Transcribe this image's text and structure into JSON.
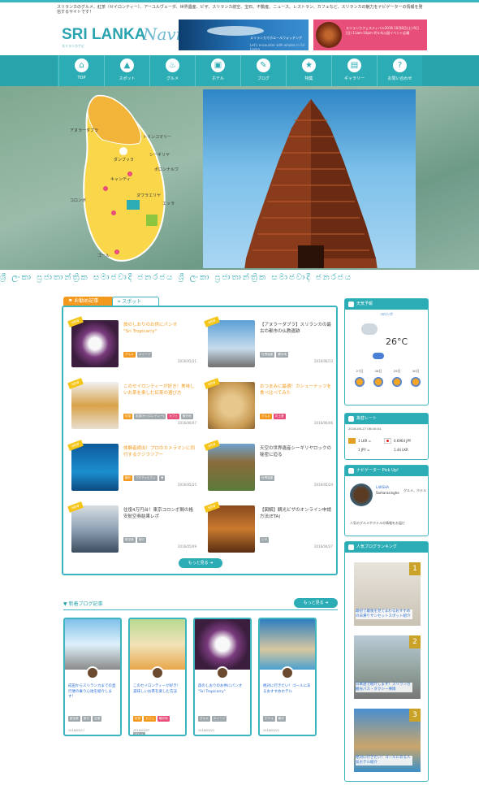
{
  "site": {
    "tagline": "スリランカのグルメ、紅茶（セイロンティー）、アーユルヴェーダ、世界遺産、ビザ、スリランカ航空、宝石、不動産、ニュース、レストラン、カフェなど、スリランカの魅力をナビゲーターの情報を発信するサイトです！",
    "logo_main": "SRI LANKA",
    "logo_script": "Navi",
    "logo_sub": "スリランカナビ"
  },
  "banners": {
    "whale_line1": "スリランカでホエールウォッチング",
    "whale_line2": "Let's encounter with whales in Sri Lanka",
    "festival_text": "スリランカフェスティバル2016 10月8日(土)-9日(日) 11am-10pm 代々木公園イベント広場"
  },
  "nav": [
    {
      "label": "TOP",
      "icon": "home-icon",
      "glyph": "⌂"
    },
    {
      "label": "スポット",
      "icon": "spot-icon",
      "glyph": "▲"
    },
    {
      "label": "グルメ",
      "icon": "gourmet-icon",
      "glyph": "♨"
    },
    {
      "label": "ホテル",
      "icon": "hotel-icon",
      "glyph": "▣"
    },
    {
      "label": "ブログ",
      "icon": "blog-icon",
      "glyph": "✎"
    },
    {
      "label": "特集",
      "icon": "feature-icon",
      "glyph": "★"
    },
    {
      "label": "ギャラリー",
      "icon": "gallery-icon",
      "glyph": "▤"
    },
    {
      "label": "お問い合わせ",
      "icon": "contact-icon",
      "glyph": "?"
    }
  ],
  "hero_map": {
    "labels": [
      "アヌラーダプラ",
      "トリンコマリー",
      "シーギリヤ",
      "ダンブッラ",
      "ポロンナルワ",
      "キャンディ",
      "コロンボ",
      "ヌワラエリヤ",
      "エッラ",
      "ゴール"
    ]
  },
  "script_band": "ශ්‍රී ලංකා ප්‍රජාතාන්ත්‍රික සමාජවාදී ජනරජය ශ්‍රී ලංකා ප්‍රජාතාන්ත්‍රික සමාජවාදී ජනරජය",
  "tabs": {
    "recommend": "お勧め記事",
    "spot": "スポット"
  },
  "articles": [
    {
      "title": "旅のしおりのお供にパンオ",
      "title2": "\"Sri Tropicarry\"",
      "date": "2016/05/21",
      "tags": [
        "グルメ",
        "スイーツ"
      ],
      "dark": false
    },
    {
      "title": "【アヌラーダプラ】スリランカの最古の都市の仏教遺跡",
      "date": "2016/06/13",
      "tags": [
        "世界遺産",
        "観光地"
      ],
      "dark": true
    },
    {
      "title": "このセイロンティーが好き！美味しいお茶を楽しむ紅茶の選び方",
      "date": "2016/06/07",
      "tags": [
        "紅茶",
        "紅茶(セイロンティー)",
        "カフェ",
        "観光地"
      ],
      "dark": false
    },
    {
      "title": "おつまみに最適！カシューナッツを食べ比べてみた",
      "date": "2016/06/06",
      "tags": [
        "グルメ",
        "お土産"
      ],
      "dark": false
    },
    {
      "title": "体験者続出！プロのカメラマンに同行するクジラツアー",
      "date": "2016/05/25",
      "tags": [
        "観光",
        "アクティビティ",
        "海"
      ],
      "dark": false
    },
    {
      "title": "天空の世界遺産シーギリヤロックの秘密に迫る",
      "date": "2016/05/24",
      "tags": [
        "世界遺産"
      ],
      "dark": true
    },
    {
      "title": "往復4万円台！東京コロンボ間の格安航空券結果レポ",
      "date": "2016/05/09",
      "tags": [
        "航空券",
        "旅行"
      ],
      "dark": true
    },
    {
      "title": "【図解】観光ビザのオンライン申請方法(ETA)",
      "date": "2016/04/27",
      "tags": [
        "ビザ"
      ],
      "dark": true
    }
  ],
  "more_label": "もっと見る",
  "blog_section": {
    "heading": "新着ブログ記事",
    "more_label": "もっと見る",
    "cards": [
      {
        "title": "成田からスリランカまでの直行便の乗り心地を紹介します！",
        "date": "2016/05/17",
        "tags": [
          "航空券",
          "旅行",
          "空港"
        ]
      },
      {
        "title": "このセイロンティーが好き！美味しいお茶を楽しむ方法",
        "date": "2016/05/07",
        "tags": [
          "紅茶",
          "カフェ",
          "観光地",
          "グルメ"
        ]
      },
      {
        "title": "旅のしおりのお供にパンオ \"Sri Tropicarry\"",
        "date": "2016/05/21",
        "tags": [
          "グルメ",
          "スイーツ"
        ]
      },
      {
        "title": "絶対に行きたい！ゴールにあるおすすめホテル",
        "date": "2016/05/21",
        "tags": [
          "ホテル",
          "観光"
        ]
      }
    ]
  },
  "weather": {
    "title": "天気予報",
    "city": "コロンボ",
    "temp": "26°C",
    "days": [
      "27日",
      "28日",
      "29日",
      "30日"
    ]
  },
  "fx": {
    "title": "為替レート",
    "updated": "2016-06-27 06:00:04",
    "row1_left": "1 LKR =",
    "row1_right": "0.6964 JPY",
    "row2_left": "1 JPY =",
    "row2_right": "1.44 LKR"
  },
  "pickup": {
    "title": "ナビゲーター Pick Up!",
    "name": "LAKSHA",
    "name2": "Samarasinghe",
    "cat": "グルメ、ホテル",
    "desc": "人気のグルメやホテルの情報をお届け"
  },
  "ranking": {
    "title": "人気ブログランキング",
    "items": [
      {
        "num": "1",
        "title": "最初で最後を見てまわるおすすめの日帰りサンセットスポット紹介"
      },
      {
        "num": "2",
        "title": "日本語で紹介します！スリランカ観光バス・タクシー事情"
      },
      {
        "num": "3",
        "title": "絶対に行きたい！ゴールにある人気ホテル紹介"
      }
    ]
  }
}
